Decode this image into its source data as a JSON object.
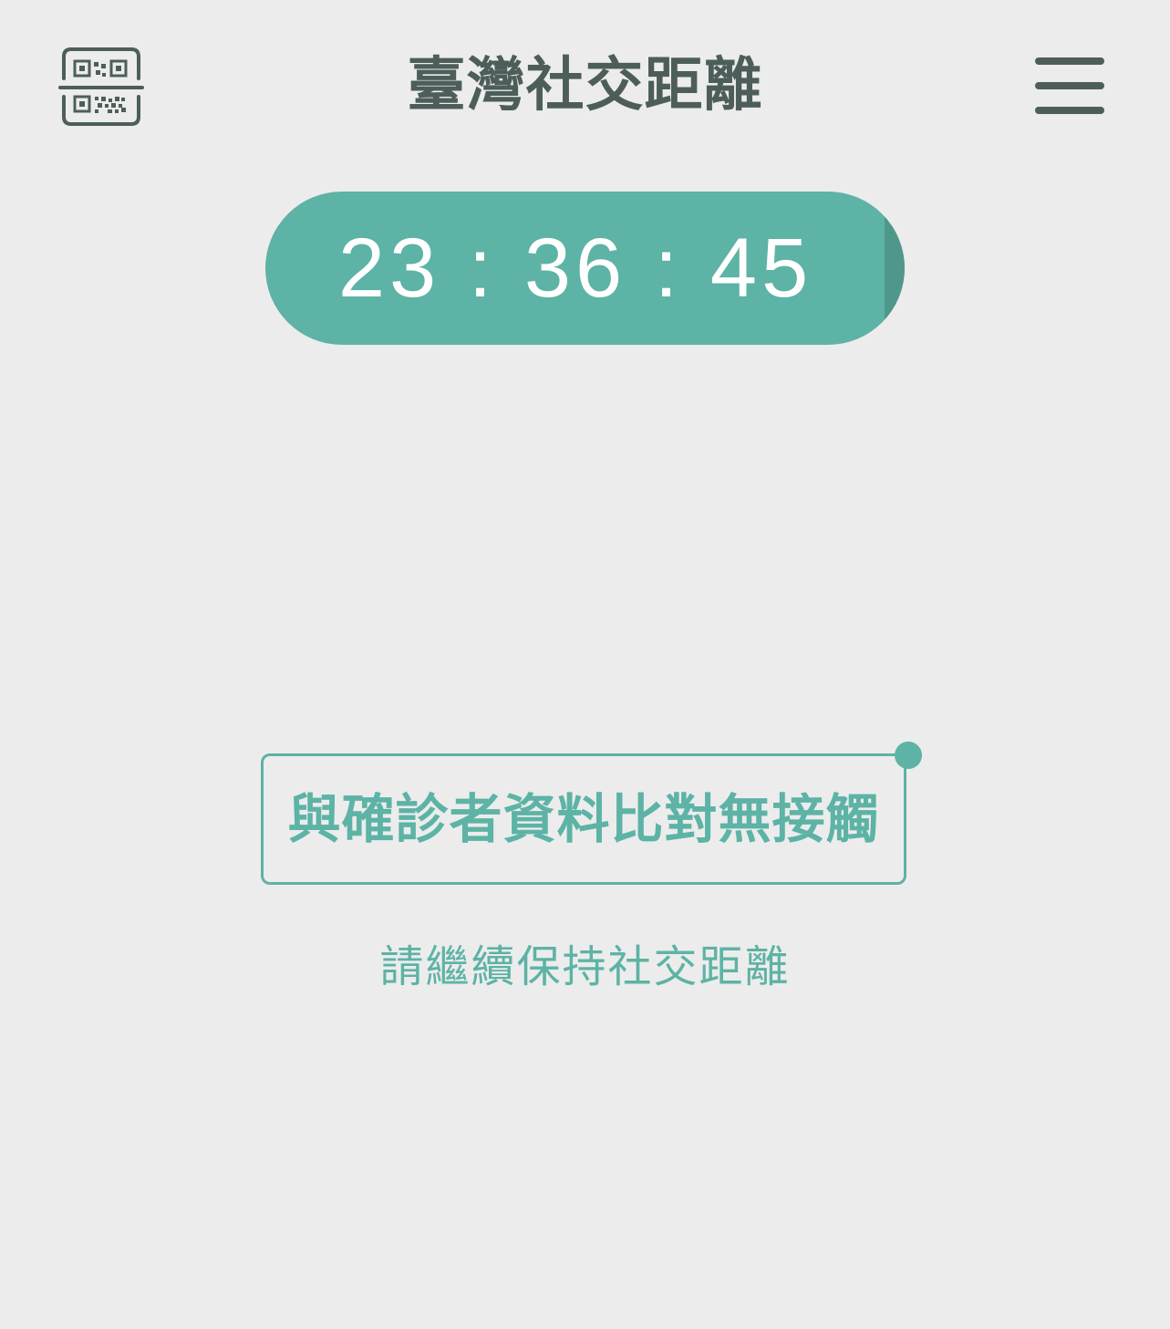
{
  "header": {
    "title": "臺灣社交距離",
    "qr_icon": "qr-code-scan-icon",
    "menu_icon": "hamburger-menu-icon"
  },
  "timer": {
    "display": "23:36:45"
  },
  "status": {
    "message": "與確診者資料比對無接觸",
    "hint": "請繼續保持社交距離"
  },
  "colors": {
    "accent": "#5db3a5",
    "accent_dark": "#4f978b",
    "header_text": "#4d5e5a",
    "background": "#ececec"
  }
}
